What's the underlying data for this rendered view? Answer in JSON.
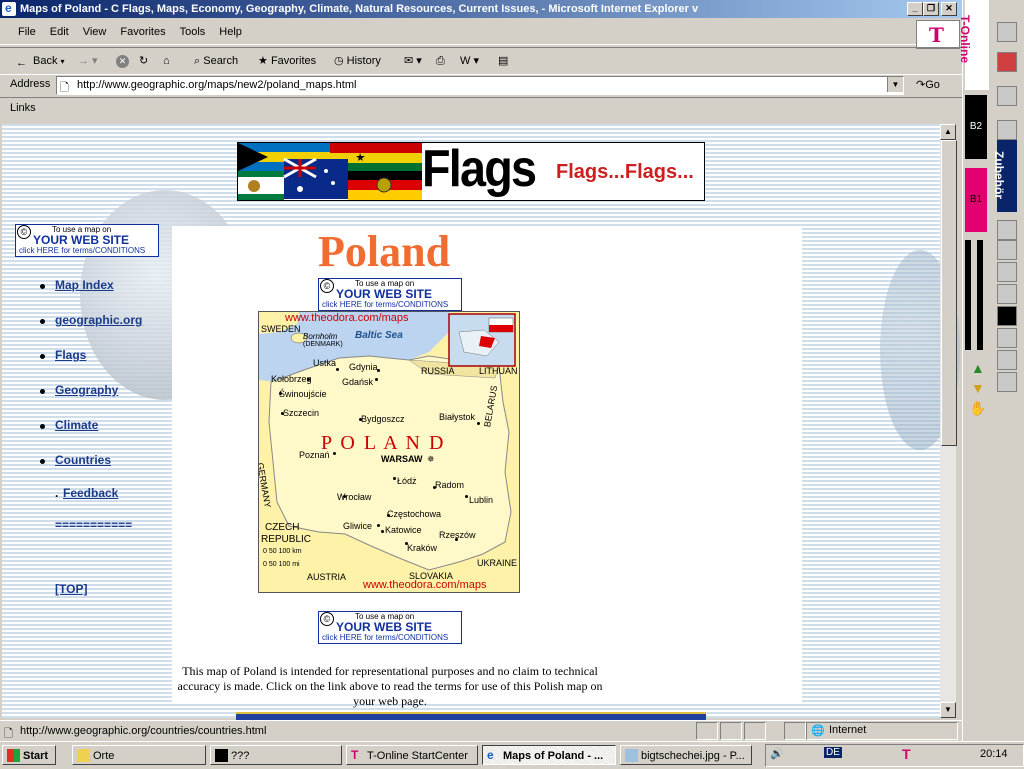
{
  "window": {
    "title": "Maps of Poland - C Flags, Maps, Economy, Geography, Climate, Natural Resources, Current Issues, - Microsoft Internet Explorer v",
    "controls": [
      "_",
      "❐",
      "✕"
    ]
  },
  "menubar": {
    "items": [
      "File",
      "Edit",
      "View",
      "Favorites",
      "Tools",
      "Help"
    ],
    "brand": "T"
  },
  "toolbar": {
    "back": "Back",
    "search": "Search",
    "favorites": "Favorites",
    "history": "History"
  },
  "address": {
    "label": "Address",
    "url": "http://www.geographic.org/maps/new2/poland_maps.html",
    "go": "Go"
  },
  "links": {
    "label": "Links"
  },
  "page": {
    "banner": {
      "word": "Flags",
      "sub": "Flags...Flags..."
    },
    "badge": {
      "line1": "To use a map on",
      "line2": "YOUR WEB SITE",
      "line3": "click HERE for terms/CONDITIONS",
      "symbol": "©"
    },
    "nav": [
      "Map Index",
      "geographic.org",
      "Flags",
      "Geography",
      "Climate",
      "Countries"
    ],
    "feedback_prefix": ".",
    "feedback": "Feedback",
    "separator": "===========",
    "top": "[TOP]",
    "heading": "Poland",
    "map": {
      "watermark_top": "www.theodora.com/maps",
      "watermark_bottom": "www.theodora.com/maps",
      "country": "P O L A N D",
      "sea": "Baltic Sea",
      "labels": {
        "sweden": "SWEDEN",
        "bornholm": "Bornholm",
        "denmark": "(DENMARK)",
        "russia": "RUSSIA",
        "lithuania": "LITHUAN",
        "belarus": "BELARUS",
        "ukraine": "UKRAINE",
        "germany": "GERMANY",
        "czech1": "CZECH",
        "czech2": "REPUBLIC",
        "slovakia": "SLOVAKIA",
        "austria": "AUSTRIA",
        "scale_km": "0   50  100 km",
        "scale_mi": "0     50      100 mi"
      },
      "cities": {
        "gdynia": "Gdynia",
        "ustka": "Ustka",
        "gdansk": "Gdańsk",
        "kolobrzeg": "Kołobrzeg",
        "swinoujscie": "Świnoujście",
        "szczecin": "Szczecin",
        "bydgoszcz": "Bydgoszcz",
        "bialystok": "Białystok",
        "poznan": "Poznań",
        "warsaw": "WARSAW",
        "lodz": "Łódż",
        "radom": "Radom",
        "lublin": "Lublin",
        "wroclaw": "Wrocław",
        "czestochowa": "Częstochowa",
        "gliwice": "Gliwice",
        "katowice": "Katowice",
        "rzeszow": "Rzeszów",
        "krakow": "Kraków"
      }
    },
    "disclaimer": "This map of Poland is intended for representational purposes and no claim to technical accuracy is made. Click on the link above to read the terms for use of this Polish map on your web page."
  },
  "status": {
    "url": "http://www.geographic.org/countries/countries.html",
    "zone": "Internet"
  },
  "tonline": {
    "title": "T-Online",
    "b2": "B2",
    "b1": "B1"
  },
  "zubehor": {
    "title": "Zubehör"
  },
  "taskbar": {
    "start": "Start",
    "tasks": [
      "Orte",
      "???",
      "T-Online StartCenter",
      "Maps of Poland - ...",
      "bigtschechei.jpg - P..."
    ],
    "clock": "20:14",
    "tray_lang": "DE"
  }
}
